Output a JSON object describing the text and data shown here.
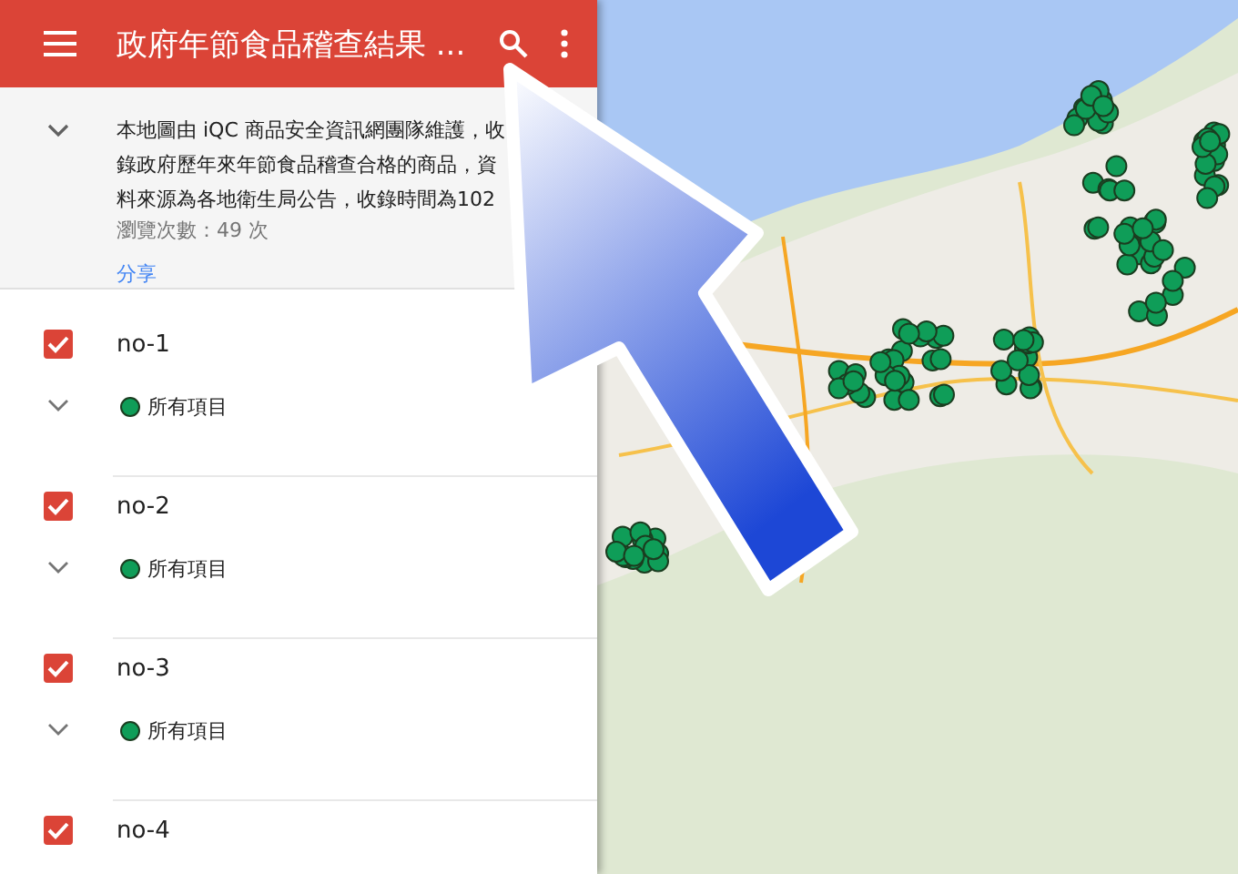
{
  "app_bar": {
    "title": "政府年節食品稽查結果 ..."
  },
  "description": {
    "expanded": true,
    "lines": [
      "本地圖由 iQC 商品安全資訊網團隊維護，收",
      "錄政府歷年來年節食品稽查合格的商品，資",
      "料來源為各地衛生局公告，收錄時間為102"
    ],
    "views": "瀏覽次數：49 次",
    "share_link": "分享"
  },
  "layers": [
    {
      "name": "no-1",
      "checked": true,
      "expanded": false,
      "legend": {
        "label": "所有項目",
        "color": "#0f9d58"
      }
    },
    {
      "name": "no-2",
      "checked": true,
      "expanded": false,
      "legend": {
        "label": "所有項目",
        "color": "#0f9d58"
      }
    },
    {
      "name": "no-3",
      "checked": true,
      "expanded": false,
      "legend": {
        "label": "所有項目",
        "color": "#0f9d58"
      }
    },
    {
      "name": "no-4",
      "checked": true
    }
  ]
}
